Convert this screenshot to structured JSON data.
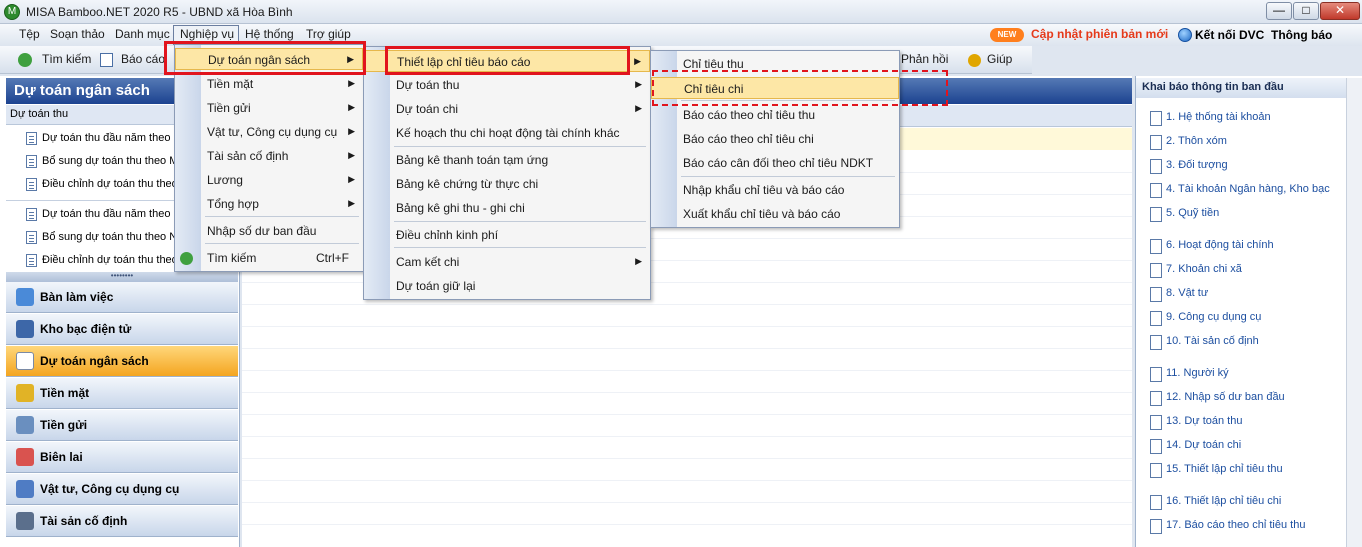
{
  "window": {
    "title": "MISA Bamboo.NET 2020 R5 - UBND xã Hòa Bình",
    "min": "—",
    "max": "□",
    "close": "✕"
  },
  "menubar": {
    "items": [
      "Tệp",
      "Soạn thảo",
      "Danh mục",
      "Nghiệp vụ",
      "Hệ thống",
      "Trợ giúp"
    ],
    "new_badge": "NEW",
    "update_link": "Cập nhật phiên bản mới",
    "connect_dvc": "Kết nối DVC",
    "notify": "Thông báo"
  },
  "toolbar": {
    "search": "Tìm kiếm",
    "report": "Báo cáo",
    "feedback": "Phản hồi",
    "help": "Giúp"
  },
  "left_panel": {
    "title": "Dự toán ngân sách",
    "subheader": "Dự toán thu",
    "items_a": [
      "Dự toán thu đầu năm theo M",
      "Bổ sung dự toán thu theo M",
      "Điều chỉnh dự toán thu theo"
    ],
    "items_b": [
      "Dự toán thu đầu năm theo N",
      "Bổ sung dự toán thu theo N",
      "Điều chỉnh dự toán thu theo"
    ],
    "splitter": "••••••••",
    "nav": [
      "Bàn làm việc",
      "Kho bạc điện tử",
      "Dự toán ngân sách",
      "Tiền mặt",
      "Tiền gửi",
      "Biên lai",
      "Vật tư, Công cụ dụng cụ",
      "Tài sản cố định"
    ]
  },
  "menu_nghiepvu": {
    "items": [
      {
        "label": "Dự toán ngân sách",
        "arrow": "▶"
      },
      {
        "label": "Tiền mặt",
        "arrow": "▶"
      },
      {
        "label": "Tiền gửi",
        "arrow": "▶"
      },
      {
        "label": "Vật tư, Công cụ dụng cụ",
        "arrow": "▶"
      },
      {
        "label": "Tài sản cố định",
        "arrow": "▶"
      },
      {
        "label": "Lương",
        "arrow": "▶"
      },
      {
        "label": "Tổng hợp",
        "arrow": "▶"
      },
      {
        "label": "Nhập số dư ban đầu",
        "arrow": ""
      },
      {
        "label": "Tìm kiếm",
        "arrow": "",
        "shortcut": "Ctrl+F"
      }
    ]
  },
  "menu_dutoan": {
    "items": [
      {
        "label": "Thiết lập chỉ tiêu báo cáo",
        "arrow": "▶"
      },
      {
        "label": "Dự toán thu",
        "arrow": "▶"
      },
      {
        "label": "Dự toán chi",
        "arrow": "▶"
      },
      {
        "label": "Kế hoạch thu chi hoạt động tài chính khác",
        "arrow": ""
      },
      {
        "label": "Bảng kê thanh toán tạm ứng",
        "arrow": ""
      },
      {
        "label": "Bảng kê chứng từ thực chi",
        "arrow": ""
      },
      {
        "label": "Bảng kê ghi thu - ghi chi",
        "arrow": ""
      },
      {
        "label": "Điều chỉnh kinh phí",
        "arrow": ""
      },
      {
        "label": "Cam kết chi",
        "arrow": "▶"
      },
      {
        "label": "Dự toán giữ lại",
        "arrow": ""
      }
    ]
  },
  "menu_thietlap": {
    "items": [
      {
        "label": "Chỉ tiêu thu"
      },
      {
        "label": "Chỉ tiêu chi"
      },
      {
        "label": "Báo cáo theo chỉ tiêu thu"
      },
      {
        "label": "Báo cáo theo chỉ tiêu chi"
      },
      {
        "label": "Báo cáo cân đối theo chỉ tiêu NDKT"
      },
      {
        "label": "Nhập khẩu chỉ tiêu và báo cáo"
      },
      {
        "label": "Xuất khẩu chỉ tiêu và báo cáo"
      }
    ]
  },
  "right_panel": {
    "title": "Khai báo thông tin ban đầu",
    "items": [
      "1. Hệ thống tài khoản",
      "2. Thôn xóm",
      "3. Đối tượng",
      "4. Tài khoản Ngân hàng, Kho bạc",
      "5. Quỹ tiền",
      "6. Hoạt động tài chính",
      "7. Khoản chi xã",
      "8. Vật tư",
      "9. Công cụ dụng cụ",
      "10. Tài sản cố định",
      "11. Người ký",
      "12. Nhập số dư ban đầu",
      "13. Dự toán thu",
      "14. Dự toán chi",
      "15. Thiết lập chỉ tiêu thu",
      "16. Thiết lập chỉ tiêu chi",
      "17. Báo cáo theo chỉ tiêu thu"
    ]
  },
  "colors": {
    "highlight": "#fde7a6",
    "annotation_red": "#e1141d",
    "header_blue": "#1c4390",
    "update_orange": "#e53a1b"
  }
}
